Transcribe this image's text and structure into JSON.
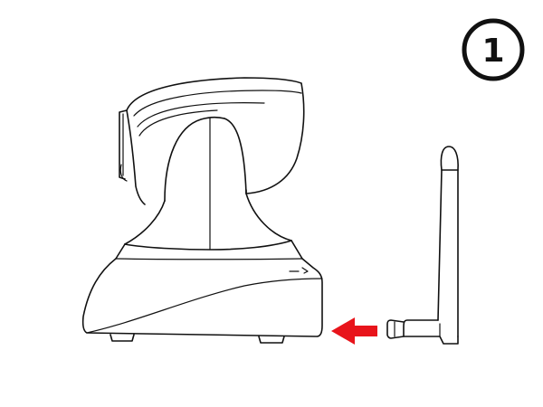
{
  "step_badge": {
    "number": "1"
  },
  "colors": {
    "line": "#111111",
    "arrow": "#e8141b",
    "background": "#ffffff"
  },
  "icons": {
    "camera": "pan-tilt-camera-side-view",
    "antenna": "wifi-antenna",
    "arrow": "insert-arrow-left"
  }
}
